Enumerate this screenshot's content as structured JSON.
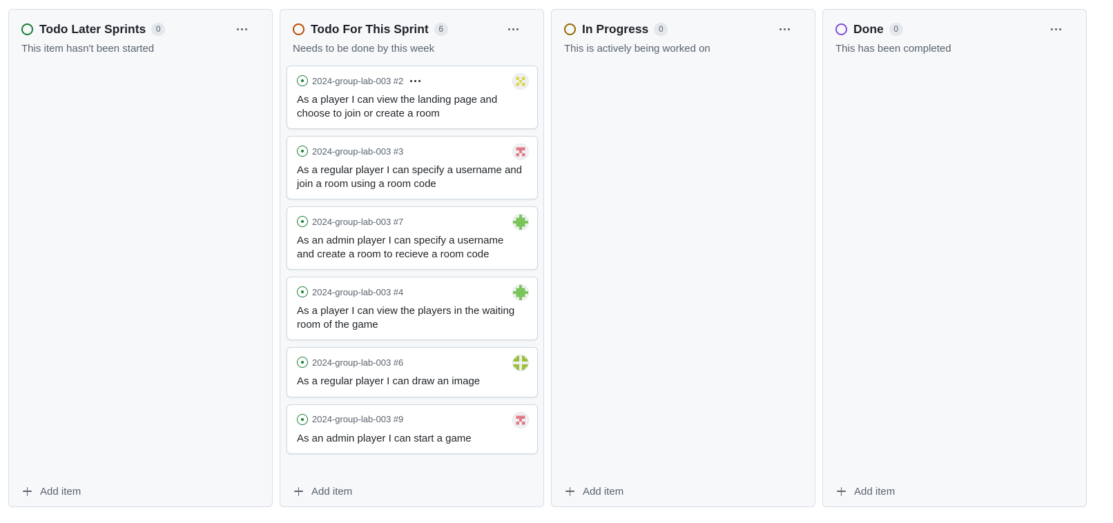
{
  "colors": {
    "todo_later": "#1a7f37",
    "todo_sprint": "#bc4c00",
    "in_progress": "#9a6700",
    "done": "#8250df",
    "issue_open": "#1a7f37"
  },
  "columns": [
    {
      "title": "Todo Later Sprints",
      "count": "0",
      "description": "This item hasn't been started",
      "add_label": "Add item",
      "cards": []
    },
    {
      "title": "Todo For This Sprint",
      "count": "6",
      "description": "Needs to be done by this week",
      "add_label": "Add item",
      "cards": [
        {
          "ref": "2024-group-lab-003 #2",
          "title": "As a player I can view the landing page and choose to join or create a room",
          "avatar": "yellow-identicon",
          "show_menu": true
        },
        {
          "ref": "2024-group-lab-003 #3",
          "title": "As a regular player I can specify a username and join a room using a room code",
          "avatar": "pink-identicon"
        },
        {
          "ref": "2024-group-lab-003 #7",
          "title": "As an admin player I can specify a username and create a room to recieve a room code",
          "avatar": "green-identicon"
        },
        {
          "ref": "2024-group-lab-003 #4",
          "title": "As a player I can view the players in the waiting room of the game",
          "avatar": "green-identicon"
        },
        {
          "ref": "2024-group-lab-003 #6",
          "title": "As a regular player I can draw an image",
          "avatar": "olive-identicon"
        },
        {
          "ref": "2024-group-lab-003 #9",
          "title": "As an admin player I can start a game",
          "avatar": "pink-identicon"
        }
      ]
    },
    {
      "title": "In Progress",
      "count": "0",
      "description": "This is actively being worked on",
      "add_label": "Add item",
      "cards": []
    },
    {
      "title": "Done",
      "count": "0",
      "description": "This has been completed",
      "add_label": "Add item",
      "cards": []
    }
  ],
  "icons": {
    "status": "circle-status-icon",
    "more": "kebab-horizontal-icon",
    "issue": "issue-opened-icon",
    "add": "plus-icon"
  }
}
